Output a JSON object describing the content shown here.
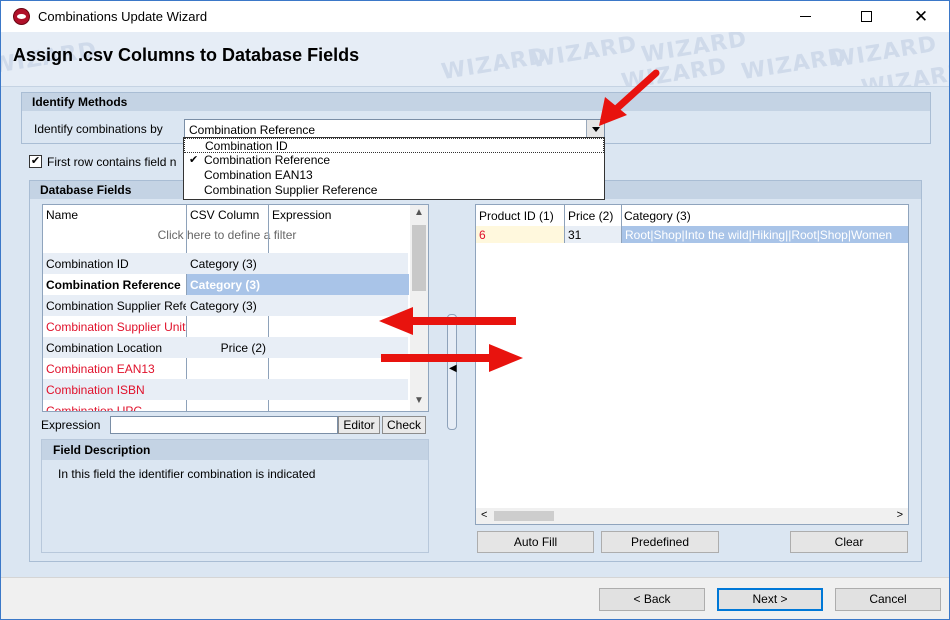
{
  "window": {
    "title": "Combinations Update Wizard",
    "minimize_label": "",
    "maximize_label": "",
    "close_label": "✕"
  },
  "banner": {
    "title": "Assign .csv Columns to Database Fields",
    "watermark": "WIZARD"
  },
  "identify": {
    "header": "Identify Methods",
    "label": "Identify combinations by",
    "selected": "Combination Reference",
    "options": [
      {
        "label": "Combination ID",
        "checked": false,
        "highlighted": true
      },
      {
        "label": "Combination Reference",
        "checked": true,
        "highlighted": false
      },
      {
        "label": "Combination EAN13",
        "checked": false,
        "highlighted": false
      },
      {
        "label": "Combination Supplier Reference",
        "checked": false,
        "highlighted": false
      }
    ]
  },
  "first_row": {
    "label": "First row contains field n",
    "checked": true
  },
  "db_fields": {
    "header": "Database Fields",
    "columns": [
      "Name",
      "CSV Column",
      "Expression"
    ],
    "filter_hint": "Click here to define a filter",
    "rows": [
      {
        "name": "Combination ID",
        "csv": "Category (3)",
        "expr": "",
        "style": "normal",
        "selected": false
      },
      {
        "name": "Combination Reference",
        "csv": "Category (3)",
        "expr": "",
        "style": "bold",
        "selected": true
      },
      {
        "name": "Combination Supplier Reference",
        "csv": "Category (3)",
        "expr": "",
        "style": "normal",
        "selected": false
      },
      {
        "name": "Combination Supplier Unit Price",
        "csv": "",
        "expr": "",
        "style": "red",
        "selected": false
      },
      {
        "name": "Combination Location",
        "csv": "Price (2)",
        "expr": "",
        "style": "normal",
        "selected": false
      },
      {
        "name": "Combination EAN13",
        "csv": "",
        "expr": "",
        "style": "red",
        "selected": false
      },
      {
        "name": "Combination ISBN",
        "csv": "",
        "expr": "",
        "style": "red",
        "selected": false
      },
      {
        "name": "Combination UPC",
        "csv": "",
        "expr": "",
        "style": "red",
        "selected": false
      }
    ]
  },
  "expression": {
    "label": "Expression",
    "value": "",
    "editor_label": "Editor",
    "check_label": "Check"
  },
  "field_description": {
    "header": "Field Description",
    "text": "In this field the identifier combination is indicated"
  },
  "preview": {
    "columns": [
      "Product ID (1)",
      "Price (2)",
      "Category (3)"
    ],
    "row": [
      "6",
      "31",
      "Root|Shop|Into the wild|Hiking||Root|Shop|Women"
    ]
  },
  "preview_buttons": {
    "auto_fill": "Auto Fill",
    "predefined": "Predefined",
    "clear": "Clear"
  },
  "footer": {
    "back": "< Back",
    "next": "Next >",
    "cancel": "Cancel"
  },
  "colors": {
    "required_field": "#e0112b",
    "selection": "#a9c4e8",
    "annotation_arrow": "#e8130e"
  }
}
